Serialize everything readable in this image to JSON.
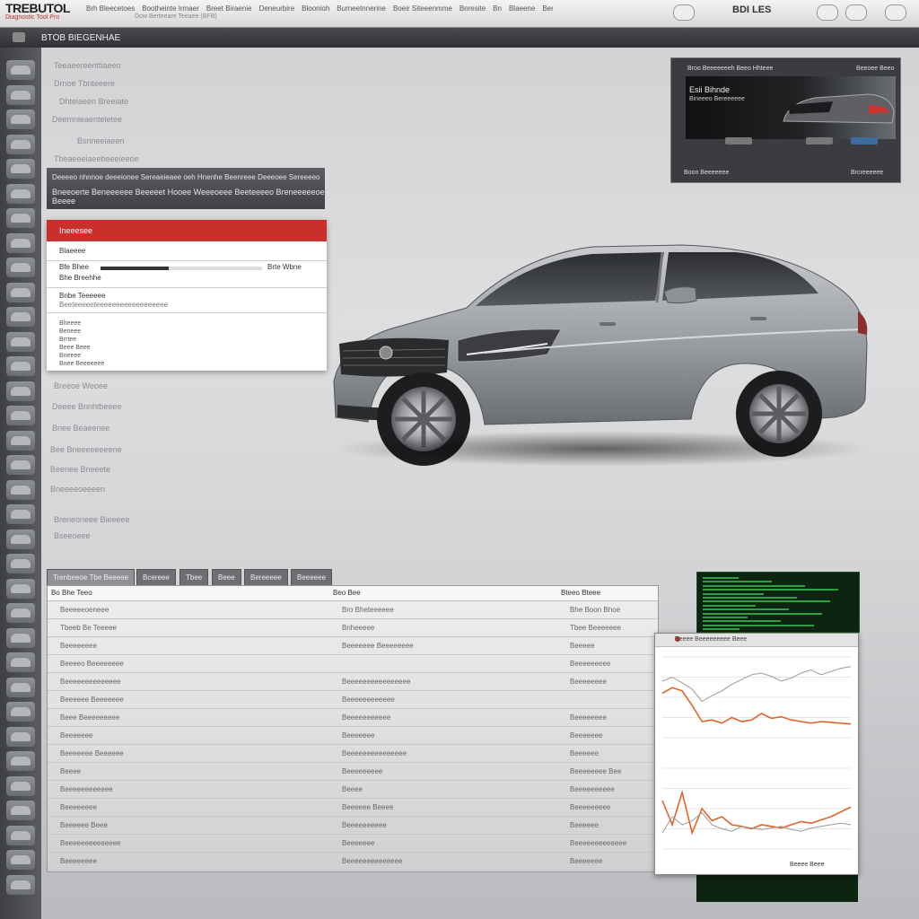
{
  "app": {
    "logo_text": "TREBUTOL",
    "logo_sub": "Diagnostic Tool Pro"
  },
  "top_menu": {
    "items": [
      "Brh Bleecetoes",
      "Bootheinte Irmaer",
      "Breet Biraenie",
      "Deneurbire",
      "Bloonioh",
      "Burneetnnerine",
      "Boeir Siteeenmme",
      "Bnresite",
      "Bn",
      "Blaeene",
      "Bero"
    ],
    "sub_text": "Dow Berteeare Teeaee (BFB)",
    "right_label": "BDI LES"
  },
  "breadcrumb": "BTOB BIEGENHAE",
  "left_text": [
    "Teeaeereenttiaeeo",
    "Drnoe Tbnteeere",
    "Dhteiaeen Breeiate",
    "Deemnieaenteietee",
    "Bsnneeiaeen",
    "Tbeaeeeiaeebeeeieeoe",
    "Breeoe Weoee",
    "Deeee Bnnhtbeeee",
    "Bnee Beaeenee",
    "Bee Bneeeeeeeene",
    "Beenee Bneeete",
    "Bneeeeoeeeen",
    "Breneoneee Bieeeee",
    "Bseeoeee"
  ],
  "dark_panel": {
    "line1": "Deeeeo nhnnoe deeeionee Sereaeieaee oeh Hnenhe Beenreee Deeeoee Sereeeeo",
    "line2": "Bneeoerte Beneeeeee Beeeeet Hooee Weeeoeee Beeteeeeo Breneeeeeoe Beeee"
  },
  "menu_panel": {
    "header": "Ineeesee",
    "row1": "Blaeeee",
    "row2_label": "Bfe Bhee",
    "row2_right": "Brte Wbne",
    "row2_sub": "Bhe Breehhe",
    "progress": 0.42,
    "row3": "Bnbe Teeeeee",
    "row3_sub": "Beeteeeeeteeeeeeeeeeeeeeeeee",
    "list": [
      "Bheeee",
      "Beneee",
      "Brrtee",
      "Beee Beee",
      "Bneeee",
      "Bnee Beeeeeee"
    ]
  },
  "promo": {
    "top_left": "Broo Beeeeeeeh Beeo Hhteee",
    "top_right": "Beeoee Beeo",
    "title": "Esii Bihnde",
    "subtitle": "Bineeeo Bereeeeee",
    "footer_left": "Boon Beeeeeee",
    "footer_right": "Brcreeeeee"
  },
  "tabs": [
    "Trenbeeoe Tbe Beeeee",
    "Bcereee",
    "Tbee",
    "Beee",
    "Bereeeee",
    "Beeeeee"
  ],
  "table": {
    "columns": [
      "Bo Bhe Teeo",
      "Beo Bee",
      "Bteeo Bteee"
    ],
    "rows": [
      [
        "Beeeeeoeneee",
        "Bro Bheteeeeee",
        "Bhe Boon Bhoe"
      ],
      [
        "Tbeeb Be Teeeee",
        "Bnheeeee",
        "Tbee Beeeeeee"
      ],
      [
        "Beeeeeeee",
        "Beeeeeee Beeeeeeee",
        "Beeeee"
      ],
      [
        "Beeeeo Beeeeeeee",
        "",
        "Beeeeeeeee"
      ],
      [
        "Beeeeeeeeeeeeee",
        "Beeeeeeeeeeeeeeee",
        "Beeeeeeee"
      ],
      [
        "Beeeeee Beeeeeee",
        "Beeeeeeeeeeee",
        ""
      ],
      [
        "Beee Beeeeeeeee",
        "Beeeeeeeeeee",
        "Beeeeeeee"
      ],
      [
        "Beeeeeee",
        "Beeeeeee",
        "Beeeeeee"
      ],
      [
        "Beeeeeee Beeeeee",
        "Beeeeeeeeeeeeeee",
        "Beeeeee"
      ],
      [
        "Beeee",
        "Beeeeeeeee",
        "Beeeeeeee Bee"
      ],
      [
        "Beeeeeeeeeeee",
        "Beeee",
        "Beeeeeeeeee"
      ],
      [
        "Beeeeeeee",
        "Beeeeee Beeee",
        "Beeeeeeeee"
      ],
      [
        "Beeeeee Beee",
        "Beeeeeeeeee",
        "Beeeeee"
      ],
      [
        "Beeeeeeeeeeeeee",
        "Beeeeeee",
        "Beeeeeeeeeeeee"
      ],
      [
        "Beeeeeeee",
        "Beeeeeeeeeeeeee",
        "Beeeeeee"
      ]
    ]
  },
  "chart_window": {
    "title": "Beeee Beeeeeeeee Beee",
    "footer": "Beeee Beee"
  },
  "chart_data": [
    {
      "type": "line",
      "title": "",
      "xlabel": "",
      "ylabel": "",
      "x": [
        0,
        1,
        2,
        3,
        4,
        5,
        6,
        7,
        8,
        9,
        10,
        11,
        12,
        13,
        14,
        15,
        16,
        17,
        18,
        19
      ],
      "series": [
        {
          "values": [
            55,
            62,
            58,
            40,
            20,
            22,
            18,
            25,
            20,
            22,
            30,
            24,
            26,
            22,
            20,
            18,
            20,
            19,
            18,
            17
          ]
        },
        {
          "values": [
            70,
            75,
            68,
            60,
            45,
            52,
            58,
            66,
            72,
            78,
            80,
            76,
            70,
            74,
            80,
            84,
            78,
            82,
            86,
            88
          ]
        }
      ],
      "ylim": [
        0,
        100
      ]
    },
    {
      "type": "line",
      "title": "",
      "xlabel": "",
      "ylabel": "",
      "x": [
        0,
        1,
        2,
        3,
        4,
        5,
        6,
        7,
        8,
        9,
        10,
        11,
        12,
        13,
        14,
        15,
        16,
        17,
        18,
        19
      ],
      "series": [
        {
          "values": [
            60,
            30,
            70,
            20,
            50,
            35,
            40,
            30,
            28,
            25,
            30,
            28,
            26,
            30,
            34,
            32,
            36,
            40,
            46,
            52
          ]
        },
        {
          "values": [
            20,
            40,
            30,
            35,
            45,
            30,
            25,
            22,
            28,
            26,
            24,
            26,
            28,
            24,
            22,
            26,
            28,
            30,
            32,
            30
          ]
        }
      ],
      "ylim": [
        0,
        100
      ]
    }
  ],
  "colors": {
    "accent_red": "#c9302c",
    "chart_orange": "#e2632a",
    "chart_gray": "#9a9a9a",
    "terminal_green": "#2ea043"
  }
}
